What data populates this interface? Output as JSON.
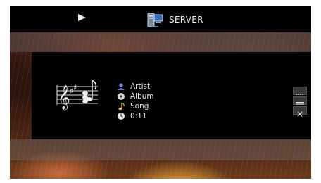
{
  "header": {
    "source_label": "SERVER",
    "play_icon": "play-icon",
    "source_icon": "server-icon"
  },
  "now_playing": {
    "artist": "Artist",
    "album": "Album",
    "song": "Song",
    "elapsed": "0:11",
    "artist_icon": "artist-icon",
    "album_icon": "album-icon",
    "song_icon": "music-note-icon",
    "time_icon": "clock-icon",
    "album_art_icon": "sheet-music-icon"
  },
  "side_controls": [
    {
      "icon": "more-options-icon"
    },
    {
      "icon": "list-icon"
    },
    {
      "icon": "close-icon"
    }
  ],
  "colors": {
    "text": "#e6e6e6",
    "artist_icon": "#7b7fd8",
    "album_icon": "#d8d8d8",
    "song_icon": "#f0c040",
    "time_icon": "#e8e8e8"
  }
}
